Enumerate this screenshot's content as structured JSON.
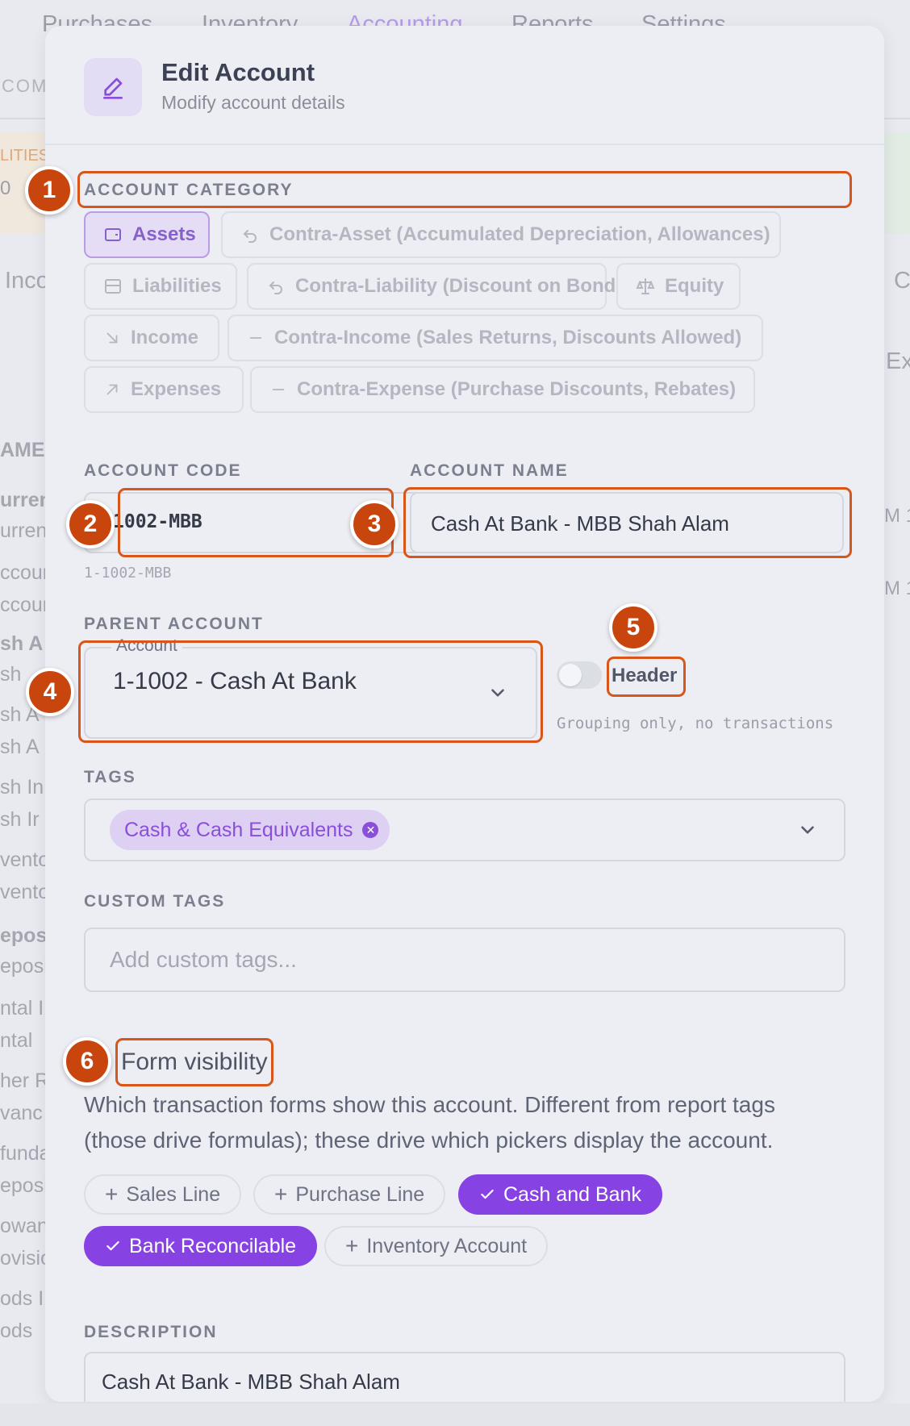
{
  "background": {
    "nav": [
      "Purchases",
      "Inventory",
      "Accounting",
      "Reports",
      "Settings"
    ],
    "left_fragments": [
      "COM",
      "LITIES",
      "0",
      "Inco",
      "AME",
      "urrent",
      "urrent",
      "ccoun",
      "ccoun",
      "sh A",
      "sh",
      "sh A",
      "sh A",
      "sh In",
      "sh Ir",
      "ventor",
      "vento",
      "eposi",
      "eposi",
      "ntal I",
      "ntal",
      "her R",
      "vanc",
      "funda",
      "eposit",
      "owan",
      "ovisio",
      "ods I",
      "ods"
    ],
    "right_fragments": [
      "C",
      "Ex",
      "М 1",
      "М 1"
    ]
  },
  "modal": {
    "title": "Edit Account",
    "subtitle": "Modify account details"
  },
  "category": {
    "label": "ACCOUNT CATEGORY",
    "options": [
      {
        "label": "Assets",
        "icon": "wallet-icon",
        "selected": true
      },
      {
        "label": "Contra-Asset (Accumulated Depreciation, Allowances)",
        "icon": "undo-icon"
      },
      {
        "label": "Liabilities",
        "icon": "ledger-icon"
      },
      {
        "label": "Contra-Liability (Discount on Bonds)",
        "icon": "undo-icon"
      },
      {
        "label": "Equity",
        "icon": "scale-icon"
      },
      {
        "label": "Income",
        "icon": "arrow-down-right-icon"
      },
      {
        "label": "Contra-Income (Sales Returns, Discounts Allowed)",
        "icon": "minus-icon"
      },
      {
        "label": "Expenses",
        "icon": "arrow-up-right-icon"
      },
      {
        "label": "Contra-Expense (Purchase Discounts, Rebates)",
        "icon": "minus-icon"
      }
    ]
  },
  "account_code": {
    "label": "ACCOUNT CODE",
    "value": "1002-MBB",
    "hint": "1-1002-MBB"
  },
  "account_name": {
    "label": "ACCOUNT NAME",
    "value": "Cash At Bank - MBB Shah Alam"
  },
  "parent_account": {
    "label": "PARENT ACCOUNT",
    "field_label": "Account",
    "value": "1-1002 - Cash At Bank"
  },
  "header_toggle": {
    "label": "Header",
    "hint": "Grouping only, no transactions",
    "on": false
  },
  "tags": {
    "label": "TAGS",
    "selected": [
      "Cash & Cash Equivalents"
    ]
  },
  "custom_tags": {
    "label": "CUSTOM TAGS",
    "placeholder": "Add custom tags..."
  },
  "form_visibility": {
    "title": "Form visibility",
    "description_line1": "Which transaction forms show this account. Different from report tags",
    "description_line2": "(those drive formulas); these drive which pickers display the account.",
    "options": [
      {
        "label": "Sales Line",
        "on": false
      },
      {
        "label": "Purchase Line",
        "on": false
      },
      {
        "label": "Cash and Bank",
        "on": true
      },
      {
        "label": "Bank Reconcilable",
        "on": true
      },
      {
        "label": "Inventory Account",
        "on": false
      }
    ]
  },
  "description": {
    "label": "DESCRIPTION",
    "value": "Cash At Bank - MBB Shah Alam"
  },
  "annotations": [
    "1",
    "2",
    "3",
    "4",
    "5",
    "6"
  ],
  "colors": {
    "accent": "#8742e3",
    "annotation": "#c8450e"
  }
}
